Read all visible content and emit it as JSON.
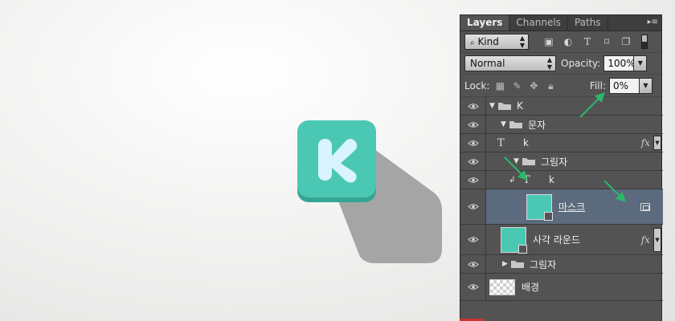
{
  "colors": {
    "accent_teal": "#4bc8b3",
    "teal_dark": "#35a693",
    "letter_fill": "#d9f4ff",
    "long_shadow": "#a5a5a5",
    "annotation_arrow": "#2aba6a",
    "selected_row": "#5c6a7d"
  },
  "artwork": {
    "letter": "K"
  },
  "panel": {
    "tabs": [
      {
        "label": "Layers",
        "active": true
      },
      {
        "label": "Channels",
        "active": false
      },
      {
        "label": "Paths",
        "active": false
      }
    ],
    "filter": {
      "kind_label": "Kind",
      "icons": [
        "image-filter-icon",
        "adjustment-filter-icon",
        "type-filter-icon",
        "shape-filter-icon",
        "smart-object-filter-icon"
      ]
    },
    "blend_mode": "Normal",
    "opacity_label": "Opacity:",
    "opacity_value": "100%",
    "lock_label": "Lock:",
    "fill_label": "Fill:",
    "fill_value": "0%"
  },
  "layers": [
    {
      "name": "K",
      "type": "group"
    },
    {
      "name": "문자",
      "type": "group"
    },
    {
      "name": "k",
      "type": "text",
      "fx": "fx"
    },
    {
      "name": "그림자",
      "type": "group"
    },
    {
      "name": "k",
      "type": "text-clipped"
    },
    {
      "name": "마스크",
      "type": "shape",
      "selected": true
    },
    {
      "name": "사각 라운드",
      "type": "shape",
      "fx": "fx"
    },
    {
      "name": "그림자",
      "type": "group-collapsed"
    },
    {
      "name": "배경",
      "type": "background"
    }
  ]
}
